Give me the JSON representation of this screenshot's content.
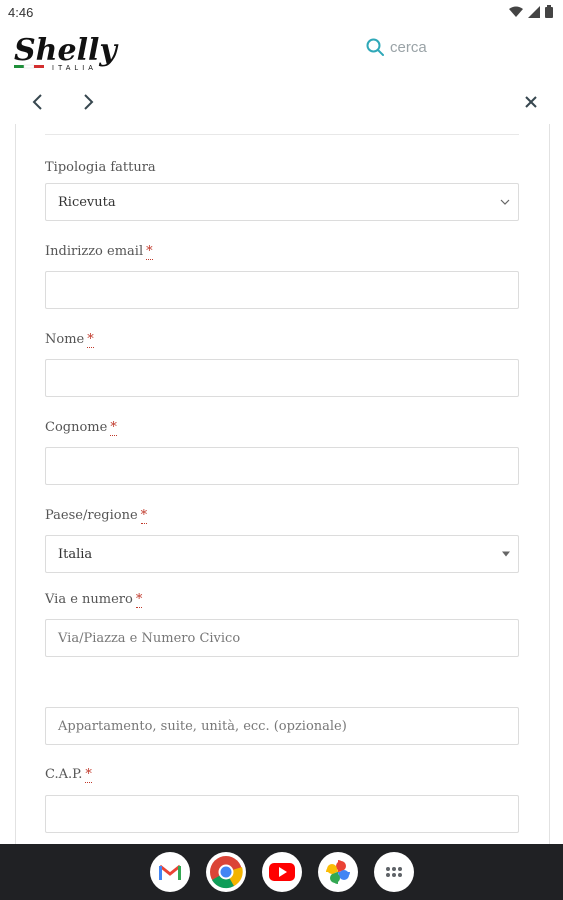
{
  "status_bar": {
    "time": "4:46"
  },
  "header": {
    "logo_text": "Shelly",
    "logo_sub": "ITALIA",
    "search_placeholder": "cerca"
  },
  "form": {
    "invoice_type": {
      "label": "Tipologia fattura",
      "value": "Ricevuta"
    },
    "email": {
      "label": "Indirizzo email",
      "required_mark": "*",
      "value": ""
    },
    "first_name": {
      "label": "Nome",
      "required_mark": "*",
      "value": ""
    },
    "last_name": {
      "label": "Cognome",
      "required_mark": "*",
      "value": ""
    },
    "country": {
      "label": "Paese/regione",
      "required_mark": "*",
      "value": "Italia"
    },
    "street": {
      "label": "Via e numero",
      "required_mark": "*",
      "placeholder": "Via/Piazza e Numero Civico"
    },
    "apartment": {
      "placeholder": "Appartamento, suite, unità, ecc. (opzionale)"
    },
    "postcode": {
      "label": "C.A.P.",
      "required_mark": "*",
      "value": ""
    }
  },
  "taskbar": {
    "apps": [
      "gmail-icon",
      "chrome-icon",
      "youtube-icon",
      "photos-icon",
      "app-drawer-icon"
    ]
  }
}
